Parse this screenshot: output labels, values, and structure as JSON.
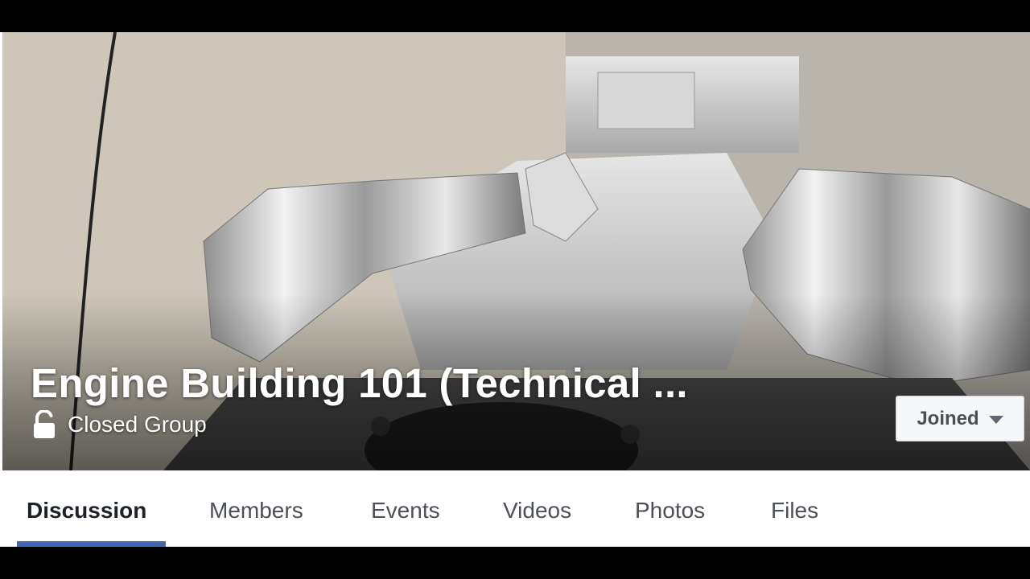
{
  "group": {
    "title": "Engine Building 101 (Technical ...",
    "privacy_label": "Closed Group",
    "privacy_icon": "lock-icon",
    "joined_label": "Joined"
  },
  "tabs": [
    {
      "label": "Discussion",
      "active": true
    },
    {
      "label": "Members",
      "active": false
    },
    {
      "label": "Events",
      "active": false
    },
    {
      "label": "Videos",
      "active": false
    },
    {
      "label": "Photos",
      "active": false
    },
    {
      "label": "Files",
      "active": false
    }
  ],
  "colors": {
    "accent": "#4267b2",
    "tab_text": "#4b4f56",
    "active_tab_text": "#1d2129"
  }
}
